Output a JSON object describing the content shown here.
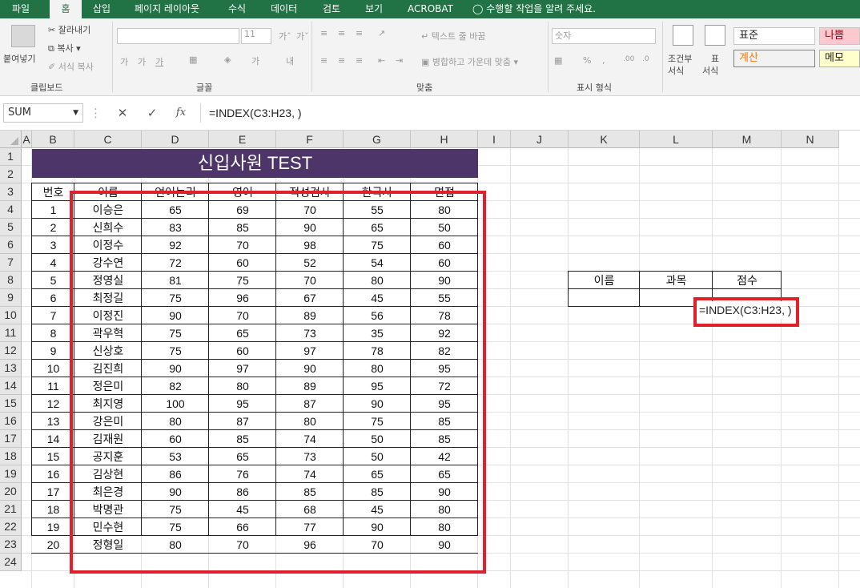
{
  "menu": {
    "tabs": [
      "파일",
      "홈",
      "삽입",
      "페이지 레이아웃",
      "수식",
      "데이터",
      "검토",
      "보기",
      "ACROBAT"
    ],
    "tell_me": "수행할 작업을 알려 주세요."
  },
  "ribbon": {
    "clipboard": {
      "paste": "붙여넣기",
      "cut": "잘라내기",
      "copy": "복사",
      "format_painter": "서식 복사",
      "label": "클립보드"
    },
    "font": {
      "size": "11",
      "label": "글꼴"
    },
    "alignment": {
      "wrap_text": "텍스트 줄 바꿈",
      "merge_center": "병합하고 가운데 맞춤",
      "label": "맞춤"
    },
    "number": {
      "format": "숫자",
      "label": "표시 형식"
    },
    "styles": {
      "conditional": "조건부",
      "conditional2": "서식",
      "table": "표",
      "table2": "서식",
      "normal": "표준",
      "bad": "나쁨",
      "calc": "계산",
      "memo": "메모"
    }
  },
  "formula_bar": {
    "name_box": "SUM",
    "fx": "fx",
    "formula": "=INDEX(C3:H23, )"
  },
  "columns": [
    "A",
    "B",
    "C",
    "D",
    "E",
    "F",
    "G",
    "H",
    "I",
    "J",
    "K",
    "L",
    "M",
    "N"
  ],
  "rows": [
    "1",
    "2",
    "3",
    "4",
    "5",
    "6",
    "7",
    "8",
    "9",
    "10",
    "11",
    "12",
    "13",
    "14",
    "15",
    "16",
    "17",
    "18",
    "19",
    "20",
    "21",
    "22",
    "23",
    "24"
  ],
  "sheet": {
    "title": "신입사원 TEST",
    "headers": [
      "번호",
      "이름",
      "언어논리",
      "영어",
      "적성검사",
      "한국사",
      "면접"
    ],
    "data": [
      [
        "1",
        "이승은",
        "65",
        "69",
        "70",
        "55",
        "80"
      ],
      [
        "2",
        "신희수",
        "83",
        "85",
        "90",
        "65",
        "50"
      ],
      [
        "3",
        "이정수",
        "92",
        "70",
        "98",
        "75",
        "60"
      ],
      [
        "4",
        "강수연",
        "72",
        "60",
        "52",
        "54",
        "60"
      ],
      [
        "5",
        "정영실",
        "81",
        "75",
        "70",
        "80",
        "90"
      ],
      [
        "6",
        "최정길",
        "75",
        "96",
        "67",
        "45",
        "55"
      ],
      [
        "7",
        "이정진",
        "90",
        "70",
        "89",
        "56",
        "78"
      ],
      [
        "8",
        "곽우혁",
        "75",
        "65",
        "73",
        "35",
        "92"
      ],
      [
        "9",
        "신상호",
        "75",
        "60",
        "97",
        "78",
        "82"
      ],
      [
        "10",
        "김진희",
        "90",
        "97",
        "90",
        "80",
        "95"
      ],
      [
        "11",
        "정은미",
        "82",
        "80",
        "89",
        "95",
        "72"
      ],
      [
        "12",
        "최지영",
        "100",
        "95",
        "87",
        "90",
        "95"
      ],
      [
        "13",
        "강은미",
        "80",
        "87",
        "80",
        "75",
        "85"
      ],
      [
        "14",
        "김재원",
        "60",
        "85",
        "74",
        "50",
        "85"
      ],
      [
        "15",
        "공지훈",
        "53",
        "65",
        "73",
        "50",
        "42"
      ],
      [
        "16",
        "김상현",
        "86",
        "76",
        "74",
        "65",
        "65"
      ],
      [
        "17",
        "최은경",
        "90",
        "86",
        "85",
        "85",
        "90"
      ],
      [
        "18",
        "박명관",
        "75",
        "45",
        "68",
        "45",
        "80"
      ],
      [
        "19",
        "민수현",
        "75",
        "66",
        "77",
        "90",
        "80"
      ],
      [
        "20",
        "정형일",
        "80",
        "70",
        "96",
        "70",
        "90"
      ]
    ],
    "lookup_headers": [
      "이름",
      "과목",
      "점수"
    ],
    "editing_formula": "=INDEX(C3:H23, )"
  }
}
